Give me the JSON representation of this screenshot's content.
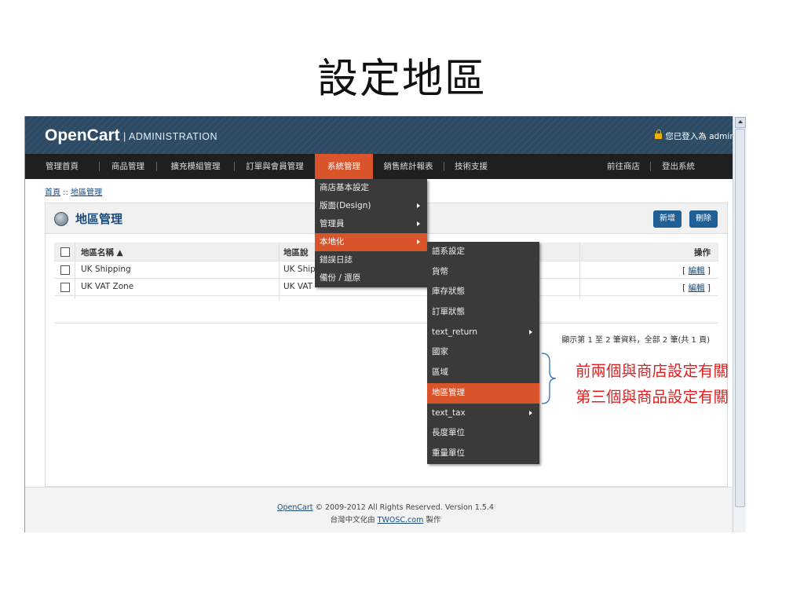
{
  "slide": {
    "title": "設定地區"
  },
  "header": {
    "logo": "OpenCart",
    "logo_sub": "ADMINISTRATION",
    "login_text": "您已登入為 admin"
  },
  "menubar": {
    "items": [
      {
        "label": "管理首頁"
      },
      {
        "label": "商品管理"
      },
      {
        "label": "擴充模組管理"
      },
      {
        "label": "訂單與會員管理"
      },
      {
        "label": "系統管理",
        "active": true
      },
      {
        "label": "銷售統計報表"
      },
      {
        "label": "技術支援"
      }
    ],
    "right_items": [
      {
        "label": "前往商店"
      },
      {
        "label": "登出系統"
      }
    ]
  },
  "breadcrumb": {
    "home": "首頁",
    "sep": " :: ",
    "current": "地區管理"
  },
  "panel": {
    "title": "地區管理",
    "add_button": "新增",
    "delete_button": "刪除"
  },
  "table": {
    "headers": {
      "name": "地區名稱 ▲",
      "desc": "地區說",
      "action": "操作"
    },
    "rows": [
      {
        "name": "UK Shipping",
        "desc": "UK Shipping Zones",
        "action": "編輯"
      },
      {
        "name": "UK VAT Zone",
        "desc": "UK VAT",
        "action": "編輯"
      }
    ]
  },
  "pagination": "顯示第 1 至 2 筆資料，全部 2 筆(共 1 頁)",
  "footer": {
    "line1_link": "OpenCart",
    "line1_text": " © 2009-2012 All Rights Reserved. Version 1.5.4",
    "line2_text": "台灣中文化由 ",
    "line2_link": "TWOSC.com",
    "line2_suffix": " 製作"
  },
  "dropdown_system": [
    {
      "label": "商店基本設定"
    },
    {
      "label": "版面(Design)",
      "submenu": true
    },
    {
      "label": "管理員",
      "submenu": true
    },
    {
      "label": "本地化",
      "submenu": true,
      "active": true
    },
    {
      "label": "錯誤日誌"
    },
    {
      "label": "備份 / 還原"
    }
  ],
  "dropdown_localisation": [
    {
      "label": "語系設定"
    },
    {
      "label": "貨幣"
    },
    {
      "label": "庫存狀態"
    },
    {
      "label": "訂單狀態"
    },
    {
      "label": "text_return",
      "submenu": true
    },
    {
      "label": "國家"
    },
    {
      "label": "區域"
    },
    {
      "label": "地區管理",
      "active": true
    },
    {
      "label": "text_tax",
      "submenu": true
    },
    {
      "label": "長度單位"
    },
    {
      "label": "重量單位"
    }
  ],
  "annotation": {
    "line1": "前兩個與商店設定有關",
    "line2": "第三個與商品設定有關"
  },
  "colors": {
    "accent": "#d9542b",
    "header": "#2c4a63",
    "menubar": "#1f1f1f",
    "annotation": "#e02020"
  }
}
